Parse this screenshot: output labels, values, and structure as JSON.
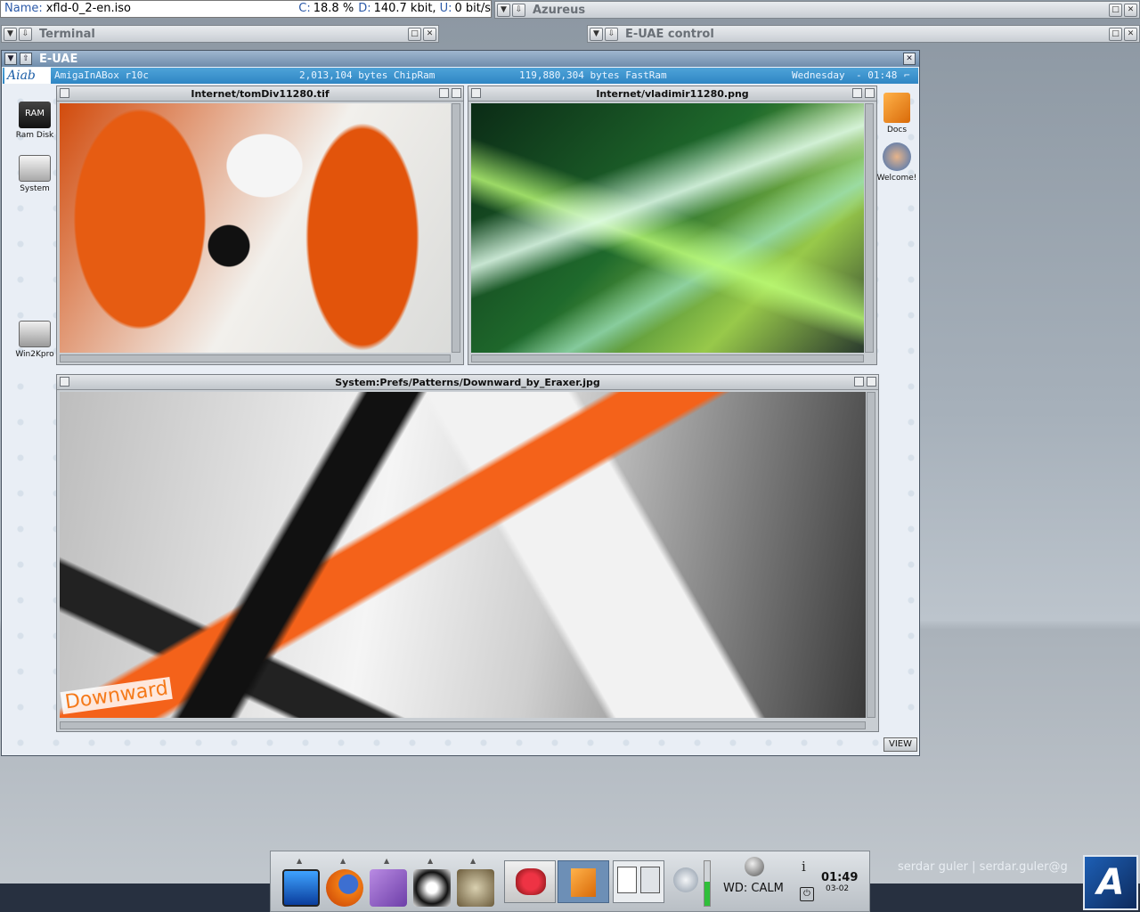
{
  "azureus_status": {
    "name_label": "Name:",
    "name_value": "xfld-0_2-en.iso",
    "c_label": "C:",
    "c_value": "18.8 %",
    "d_label": "D:",
    "d_value": "140.7 kbit,",
    "u_label": "U:",
    "u_value": "0 bit/s"
  },
  "windows": {
    "azureus": "Azureus",
    "terminal": "Terminal",
    "euae_control": "E-UAE control",
    "euae": "E-UAE"
  },
  "amiga_bar": {
    "logo": "Aiab",
    "version": "AmigaInABox r10c",
    "chipram": "2,013,104 bytes ChipRam",
    "fastram": "119,880,304 bytes FastRam",
    "day": "Wednesday",
    "time": "- 01:48"
  },
  "desktop_icons": {
    "ramdisk": "Ram Disk",
    "ramdisk_face": "RAM",
    "system": "System",
    "win2kpro": "Win2Kpro",
    "docs": "Docs",
    "welcome": "Welcome!"
  },
  "viewers": {
    "tomdiv": "Internet/tomDiv11280.tif",
    "vladimir": "Internet/vladimir11280.png",
    "downward": "System:Prefs/Patterns/Downward_by_Eraxer.jpg",
    "downward_logo": "Downward"
  },
  "view_button": "VIEW",
  "taskbar": {
    "weather": "WD: CALM",
    "time": "01:49",
    "date": "03-02",
    "info": "i",
    "volume_level": 0.55
  },
  "credit": "serdar guler  |  serdar.guler@g",
  "colors": {
    "amiga_bar": "#2f86c4",
    "orange": "#e65c12",
    "volume": "#2fbf3a"
  }
}
